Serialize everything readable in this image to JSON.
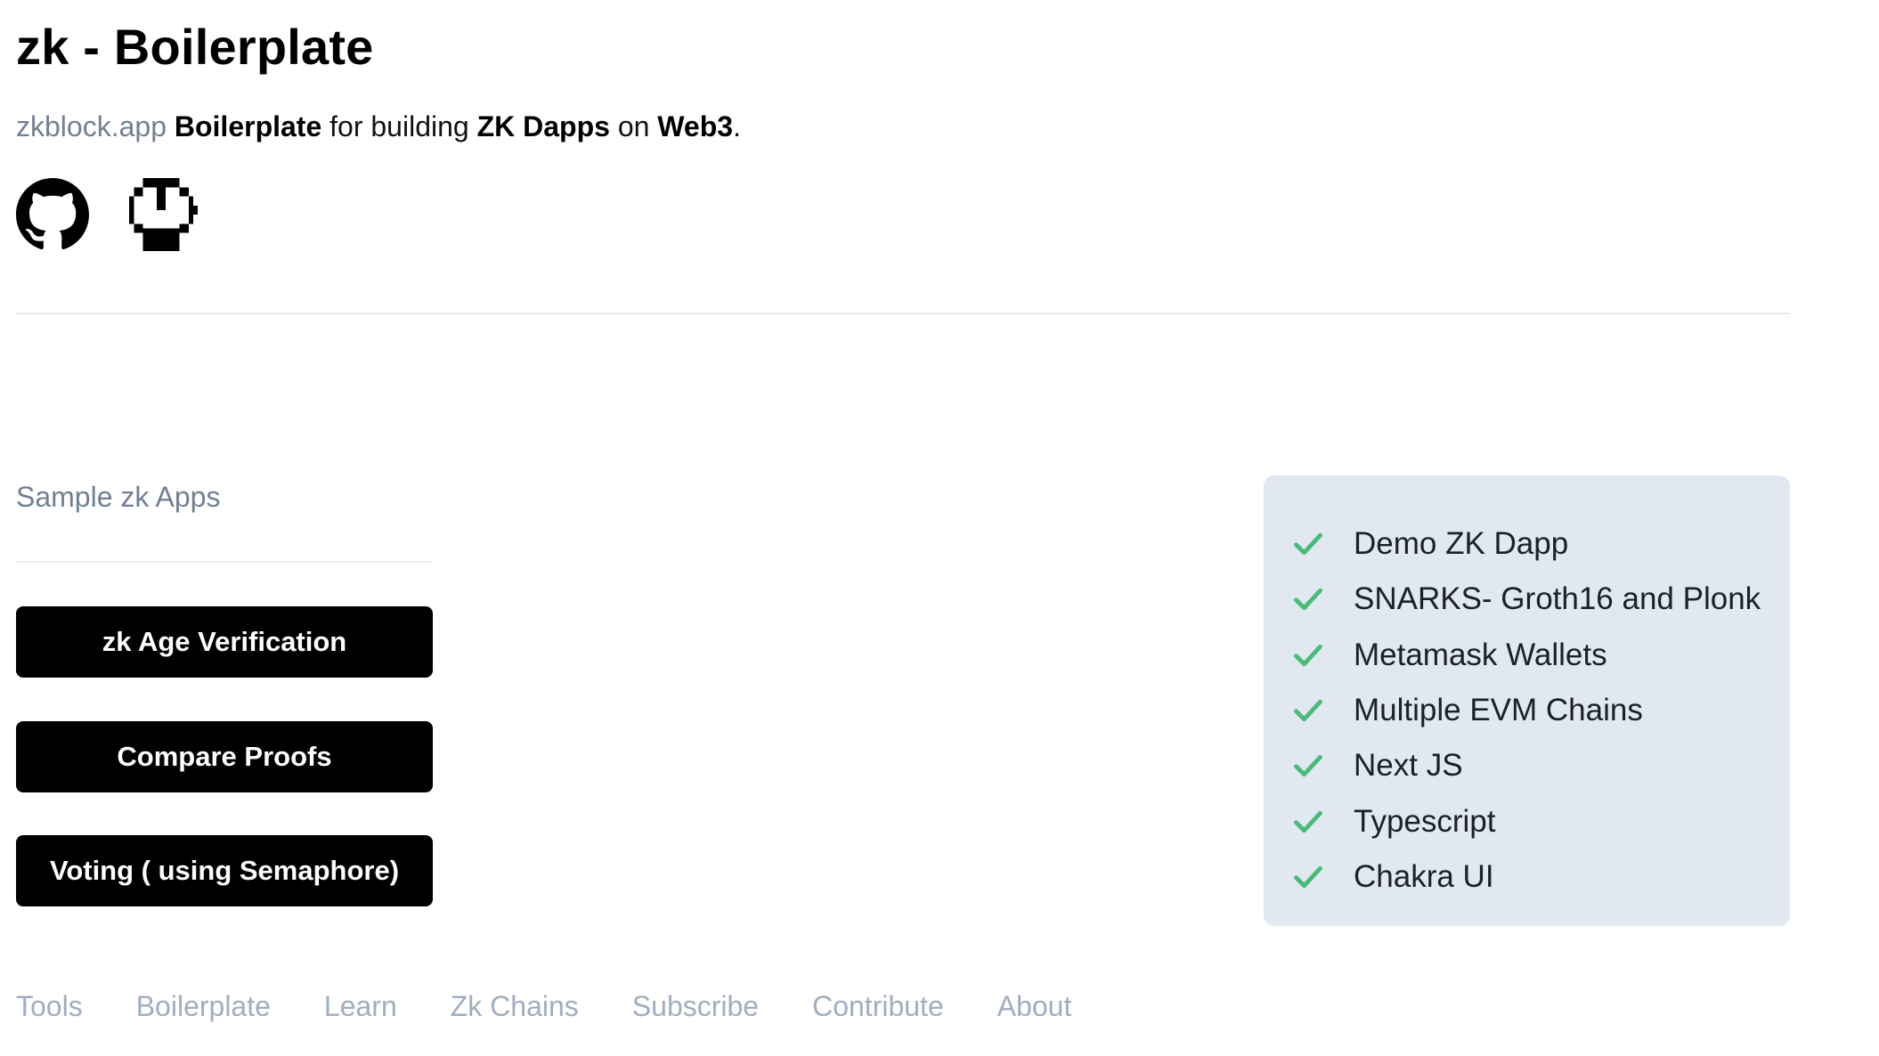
{
  "header": {
    "title": "zk - Boilerplate",
    "tagline": {
      "site": "zkblock.app",
      "boilerplate": "Boilerplate",
      "for_building": "for building",
      "zk_dapps": "ZK Dapps",
      "on": "on",
      "web3": "Web3",
      "period": "."
    },
    "icons": [
      "github-icon",
      "pixel-power-icon"
    ]
  },
  "apps": {
    "section_label": "Sample zk Apps",
    "buttons": [
      "zk Age Verification",
      "Compare Proofs",
      "Voting ( using Semaphore)"
    ]
  },
  "features": {
    "icon": "check-icon",
    "check_color": "#48bb78",
    "items": [
      "Demo ZK Dapp",
      "SNARKS- Groth16 and Plonk",
      "Metamask Wallets",
      "Multiple EVM Chains",
      "Next JS",
      "Typescript",
      "Chakra UI"
    ]
  },
  "footer": {
    "links": [
      "Tools",
      "Boilerplate",
      "Learn",
      "Zk Chains",
      "Subscribe",
      "Contribute",
      "About"
    ]
  }
}
